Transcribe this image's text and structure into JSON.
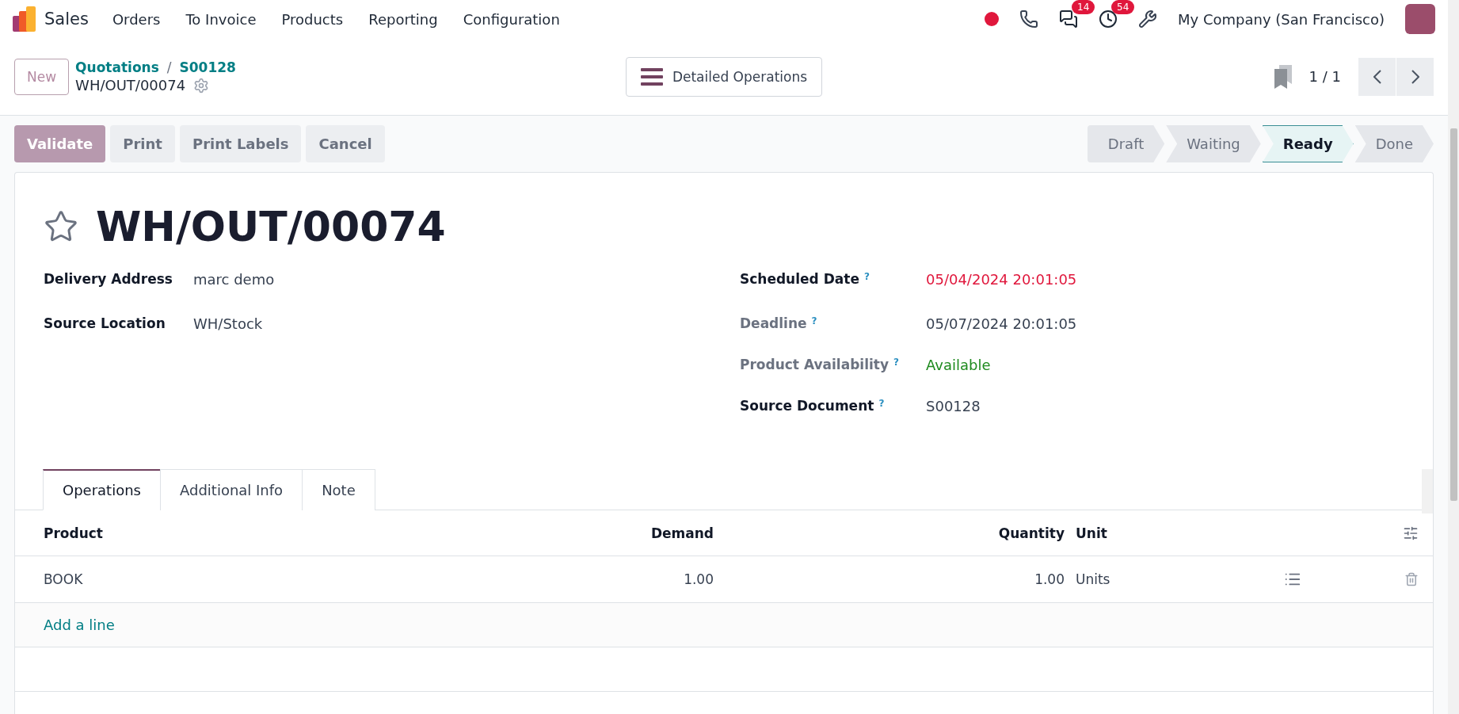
{
  "navbar": {
    "app": "Sales",
    "menu": [
      "Orders",
      "To Invoice",
      "Products",
      "Reporting",
      "Configuration"
    ],
    "chat_count": "14",
    "activity_count": "54",
    "company": "My Company (San Francisco)"
  },
  "control_panel": {
    "new_button": "New",
    "breadcrumbs": [
      "Quotations",
      "S00128"
    ],
    "separator": "/",
    "current": "WH/OUT/00074",
    "center_button": "Detailed Operations",
    "pager": "1 / 1"
  },
  "actions": [
    {
      "label": "Validate",
      "kind": "primary"
    },
    {
      "label": "Print",
      "kind": "secondary"
    },
    {
      "label": "Print Labels",
      "kind": "secondary"
    },
    {
      "label": "Cancel",
      "kind": "secondary"
    }
  ],
  "statusbar": [
    {
      "label": "Draft",
      "selected": false
    },
    {
      "label": "Waiting",
      "selected": false
    },
    {
      "label": "Ready",
      "selected": true
    },
    {
      "label": "Done",
      "selected": false
    }
  ],
  "form": {
    "title": "WH/OUT/00074",
    "starred": false,
    "left_fields": [
      {
        "label": "Delivery Address",
        "value": "marc demo",
        "required": true,
        "color": "#374151"
      },
      {
        "label": "Source Location",
        "value": "WH/Stock",
        "required": true,
        "color": "#374151"
      }
    ],
    "right_fields": [
      {
        "label": "Scheduled Date",
        "help": "?",
        "value": "05/04/2024 20:01:05",
        "required": true,
        "color": "#e0173c"
      },
      {
        "label": "Deadline",
        "help": "?",
        "value": "05/07/2024 20:01:05",
        "required": false,
        "color": "#374151"
      },
      {
        "label": "Product Availability",
        "help": "?",
        "value": "Available",
        "required": false,
        "color": "#1e8a1e"
      },
      {
        "label": "Source Document",
        "help": "?",
        "value": "S00128",
        "required": true,
        "color": "#374151"
      }
    ]
  },
  "tabs": [
    {
      "label": "Operations",
      "selected": true
    },
    {
      "label": "Additional Info",
      "selected": false
    },
    {
      "label": "Note",
      "selected": false
    }
  ],
  "table": {
    "columns": [
      "Product",
      "Demand",
      "Quantity",
      "Unit"
    ],
    "rows": [
      {
        "product": "BOOK",
        "demand": "1.00",
        "quantity": "1.00",
        "unit": "Units"
      }
    ],
    "add_line": "Add a line"
  }
}
